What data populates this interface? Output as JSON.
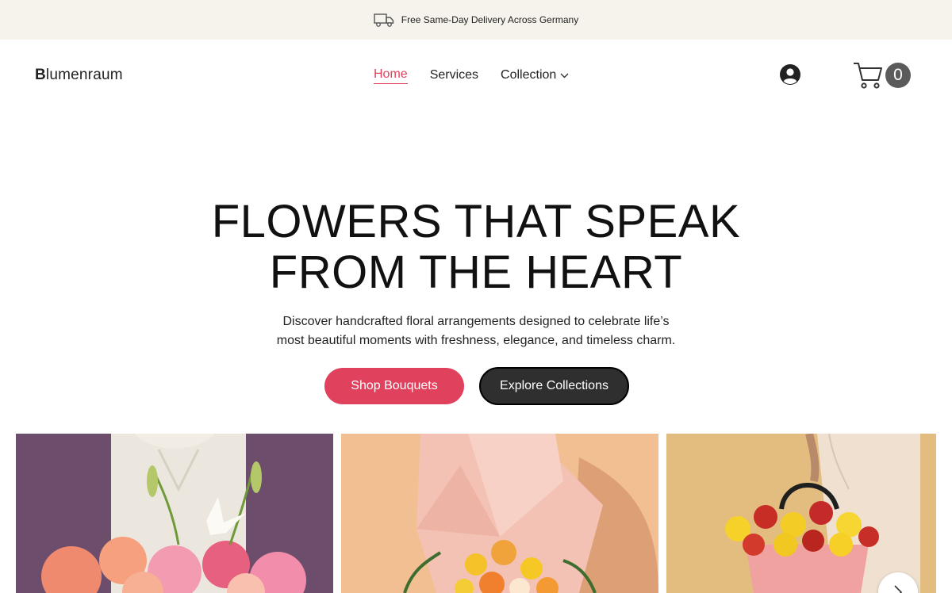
{
  "announcement": {
    "text": "Free Same-Day Delivery Across Germany",
    "icon": "truck-icon"
  },
  "header": {
    "logo_initial": "B",
    "logo_rest": "lumenraum",
    "nav": [
      {
        "label": "Home",
        "active": true
      },
      {
        "label": "Services",
        "active": false
      },
      {
        "label": "Collection",
        "active": false,
        "has_dropdown": true
      }
    ],
    "account_icon": "user-circle-icon",
    "cart_icon": "shopping-cart-icon",
    "cart_count": "0"
  },
  "hero": {
    "title_line1": "FLOWERS THAT SPEAK",
    "title_line2": "FROM THE HEART",
    "subtitle_line1": "Discover handcrafted floral arrangements designed to celebrate life’s",
    "subtitle_line2": "most beautiful moments with freshness, elegance, and timeless charm.",
    "primary_button": "Shop Bouquets",
    "secondary_button": "Explore Collections"
  },
  "gallery": {
    "cards": [
      {
        "name": "person-holding-rose-and-lily-bouquet-photo"
      },
      {
        "name": "pink-wrapped-bouquet-photo"
      },
      {
        "name": "flower-bag-gerbera-photo"
      }
    ],
    "next_icon": "chevron-right-icon"
  },
  "colors": {
    "accent": "#e0425e",
    "dark_button": "#2f2f2f",
    "topbar_bg": "#f6f2ec",
    "cart_badge": "#5b5b5b"
  }
}
